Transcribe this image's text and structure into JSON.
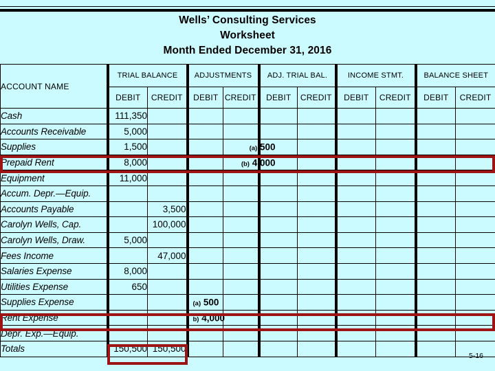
{
  "slide": {
    "number": "5-16",
    "background_color": "#ccfbff",
    "highlight_color": "#9e1414"
  },
  "title": {
    "line1": "Wells’ Consulting Services",
    "line2": "Worksheet",
    "line3": "Month Ended December 31, 2016"
  },
  "table": {
    "account_name_header": "ACCOUNT NAME",
    "column_groups": [
      {
        "label": "TRIAL BALANCE"
      },
      {
        "label": "ADJUSTMENTS"
      },
      {
        "label": "ADJ. TRIAL BAL."
      },
      {
        "label": "INCOME STMT."
      },
      {
        "label": "BALANCE SHEET"
      }
    ],
    "sub_headers": {
      "debit": "DEBIT",
      "credit": "CREDIT"
    },
    "rows": [
      {
        "account": "Cash",
        "tb_debit": "111,350",
        "tb_credit": "",
        "adj_debit": "",
        "adj_debit_ref": "",
        "adj_credit": "",
        "adj_credit_ref": "",
        "atb_debit": "",
        "atb_credit": "",
        "is_debit": "",
        "is_credit": "",
        "bs_debit": "",
        "bs_credit": ""
      },
      {
        "account": "Accounts Receivable",
        "tb_debit": "5,000",
        "tb_credit": "",
        "adj_debit": "",
        "adj_debit_ref": "",
        "adj_credit": "",
        "adj_credit_ref": "",
        "atb_debit": "",
        "atb_credit": "",
        "is_debit": "",
        "is_credit": "",
        "bs_debit": "",
        "bs_credit": ""
      },
      {
        "account": "Supplies",
        "tb_debit": "1,500",
        "tb_credit": "",
        "adj_debit": "",
        "adj_debit_ref": "",
        "adj_credit": "500",
        "adj_credit_ref": "(a)",
        "atb_debit": "",
        "atb_credit": "",
        "is_debit": "",
        "is_credit": "",
        "bs_debit": "",
        "bs_credit": ""
      },
      {
        "account": "Prepaid Rent",
        "tb_debit": "8,000",
        "tb_credit": "",
        "adj_debit": "",
        "adj_debit_ref": "",
        "adj_credit": "4,000",
        "adj_credit_ref": "(b)",
        "atb_debit": "",
        "atb_credit": "",
        "is_debit": "",
        "is_credit": "",
        "bs_debit": "",
        "bs_credit": ""
      },
      {
        "account": "Equipment",
        "tb_debit": "11,000",
        "tb_credit": "",
        "adj_debit": "",
        "adj_debit_ref": "",
        "adj_credit": "",
        "adj_credit_ref": "",
        "atb_debit": "",
        "atb_credit": "",
        "is_debit": "",
        "is_credit": "",
        "bs_debit": "",
        "bs_credit": ""
      },
      {
        "account": "Accum. Depr.—Equip.",
        "tb_debit": "",
        "tb_credit": "",
        "adj_debit": "",
        "adj_debit_ref": "",
        "adj_credit": "",
        "adj_credit_ref": "",
        "atb_debit": "",
        "atb_credit": "",
        "is_debit": "",
        "is_credit": "",
        "bs_debit": "",
        "bs_credit": ""
      },
      {
        "account": "Accounts Payable",
        "tb_debit": "",
        "tb_credit": "3,500",
        "adj_debit": "",
        "adj_debit_ref": "",
        "adj_credit": "",
        "adj_credit_ref": "",
        "atb_debit": "",
        "atb_credit": "",
        "is_debit": "",
        "is_credit": "",
        "bs_debit": "",
        "bs_credit": ""
      },
      {
        "account": "Carolyn Wells, Cap.",
        "tb_debit": "",
        "tb_credit": "100,000",
        "adj_debit": "",
        "adj_debit_ref": "",
        "adj_credit": "",
        "adj_credit_ref": "",
        "atb_debit": "",
        "atb_credit": "",
        "is_debit": "",
        "is_credit": "",
        "bs_debit": "",
        "bs_credit": ""
      },
      {
        "account": "Carolyn Wells, Draw.",
        "tb_debit": "5,000",
        "tb_credit": "",
        "adj_debit": "",
        "adj_debit_ref": "",
        "adj_credit": "",
        "adj_credit_ref": "",
        "atb_debit": "",
        "atb_credit": "",
        "is_debit": "",
        "is_credit": "",
        "bs_debit": "",
        "bs_credit": ""
      },
      {
        "account": "Fees Income",
        "tb_debit": "",
        "tb_credit": "47,000",
        "adj_debit": "",
        "adj_debit_ref": "",
        "adj_credit": "",
        "adj_credit_ref": "",
        "atb_debit": "",
        "atb_credit": "",
        "is_debit": "",
        "is_credit": "",
        "bs_debit": "",
        "bs_credit": ""
      },
      {
        "account": "Salaries Expense",
        "tb_debit": "8,000",
        "tb_credit": "",
        "adj_debit": "",
        "adj_debit_ref": "",
        "adj_credit": "",
        "adj_credit_ref": "",
        "atb_debit": "",
        "atb_credit": "",
        "is_debit": "",
        "is_credit": "",
        "bs_debit": "",
        "bs_credit": ""
      },
      {
        "account": "Utilities Expense",
        "tb_debit": "650",
        "tb_credit": "",
        "adj_debit": "",
        "adj_debit_ref": "",
        "adj_credit": "",
        "adj_credit_ref": "",
        "atb_debit": "",
        "atb_credit": "",
        "is_debit": "",
        "is_credit": "",
        "bs_debit": "",
        "bs_credit": ""
      },
      {
        "account": "Supplies Expense",
        "tb_debit": "",
        "tb_credit": "",
        "adj_debit": "500",
        "adj_debit_ref": "(a)",
        "adj_credit": "",
        "adj_credit_ref": "",
        "atb_debit": "",
        "atb_credit": "",
        "is_debit": "",
        "is_credit": "",
        "bs_debit": "",
        "bs_credit": ""
      },
      {
        "account": "Rent Expense",
        "tb_debit": "",
        "tb_credit": "",
        "adj_debit": "4,000",
        "adj_debit_ref": "b)",
        "adj_credit": "",
        "adj_credit_ref": "",
        "atb_debit": "",
        "atb_credit": "",
        "is_debit": "",
        "is_credit": "",
        "bs_debit": "",
        "bs_credit": ""
      },
      {
        "account": "Depr. Exp.—Equip.",
        "tb_debit": "",
        "tb_credit": "",
        "adj_debit": "",
        "adj_debit_ref": "",
        "adj_credit": "",
        "adj_credit_ref": "",
        "atb_debit": "",
        "atb_credit": "",
        "is_debit": "",
        "is_credit": "",
        "bs_debit": "",
        "bs_credit": ""
      },
      {
        "account": "Totals",
        "tb_debit": "150,500",
        "tb_credit": "150,500",
        "adj_debit": "",
        "adj_debit_ref": "",
        "adj_credit": "",
        "adj_credit_ref": "",
        "atb_debit": "",
        "atb_credit": "",
        "is_debit": "",
        "is_credit": "",
        "bs_debit": "",
        "bs_credit": ""
      }
    ]
  }
}
